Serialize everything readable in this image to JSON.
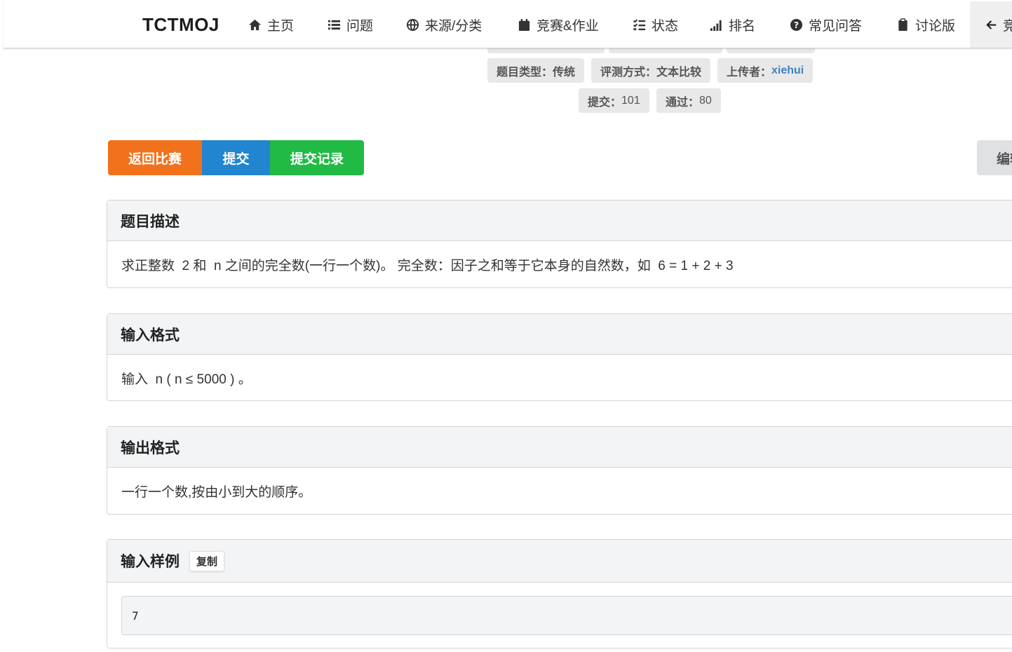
{
  "nav": {
    "brand": "TCTMOJ",
    "items": [
      {
        "label": "主页",
        "icon": "home-icon"
      },
      {
        "label": "问题",
        "icon": "list-icon"
      },
      {
        "label": "来源/分类",
        "icon": "globe-icon"
      },
      {
        "label": "竞赛&作业",
        "icon": "calendar-icon"
      },
      {
        "label": "状态",
        "icon": "tasks-icon"
      },
      {
        "label": "排名",
        "icon": "signal-icon"
      },
      {
        "label": "常见问答",
        "icon": "question-circle-icon"
      },
      {
        "label": "讨论版",
        "icon": "clipboard-icon"
      }
    ],
    "back_label": "竞"
  },
  "meta": {
    "type_label": "题目类型：",
    "type_value": "传统",
    "judge_label": "评测方式：",
    "judge_value": "文本比较",
    "uploader_label": "上传者：",
    "uploader_value": "xiehui",
    "submit_label": "提交：",
    "submit_value": "101",
    "pass_label": "通过：",
    "pass_value": "80"
  },
  "actions": {
    "back_to_contest": "返回比赛",
    "submit": "提交",
    "submit_records": "提交记录",
    "edit": "编辑"
  },
  "sections": {
    "description": {
      "title": "题目描述",
      "text": "求正整数  2 和  n 之间的完全数(一行一个数)。 完全数：因子之和等于它本身的自然数，如  6 = 1 + 2 + 3"
    },
    "input_format": {
      "title": "输入格式",
      "text": "输入  n ( n ≤ 5000 ) 。"
    },
    "output_format": {
      "title": "输出格式",
      "text": "一行一个数,按由小到大的顺序。"
    },
    "sample_input": {
      "title": "输入样例",
      "copy_label": "复制",
      "code": "7"
    }
  }
}
